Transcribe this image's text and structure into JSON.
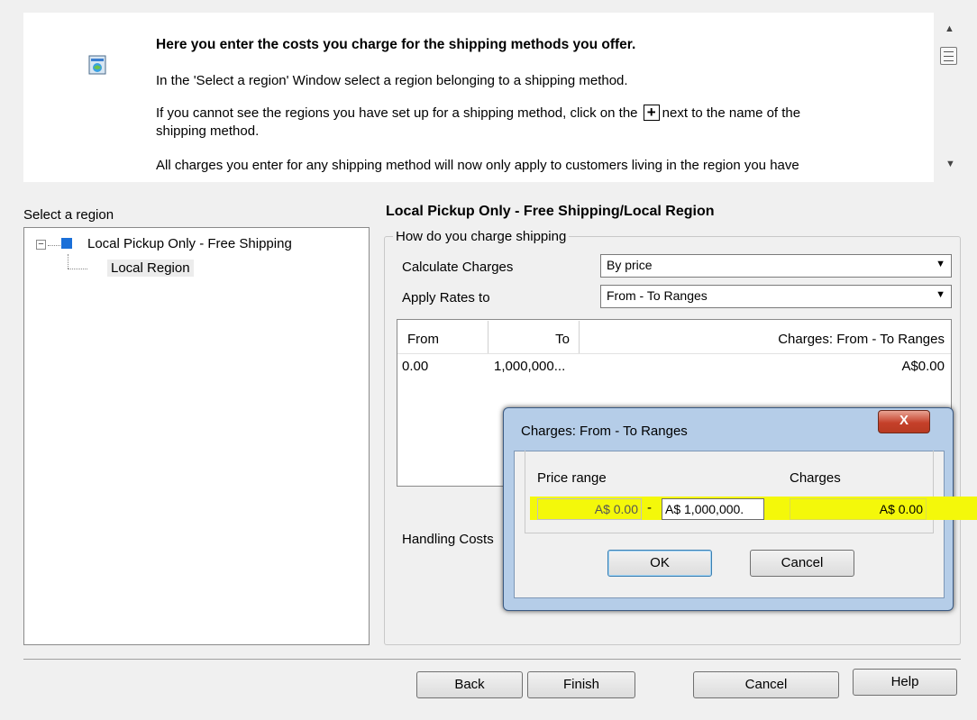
{
  "info": {
    "heading": "Here you enter the costs you charge for the shipping methods you offer.",
    "line1": "In the 'Select a region' Window select a region belonging to a shipping method.",
    "line2_before": "If you cannot see the regions you have set up for a shipping method, click on the ",
    "line2_after": "next to the name of the",
    "line2_cont": "shipping method.",
    "line3": "All charges you enter for any shipping method will now only apply to customers living in the region you have",
    "icons": {
      "info": "wizard-icon",
      "plus": "plus-icon"
    }
  },
  "tree": {
    "label": "Select a region",
    "root": "Local Pickup Only - Free Shipping",
    "child": "Local Region",
    "expander_glyph": "−"
  },
  "region_panel": {
    "title": "Local Pickup Only - Free Shipping/Local Region",
    "group_label": "How do you charge shipping",
    "calc_label": "Calculate Charges",
    "calc_value": "By price",
    "apply_label": "Apply Rates to",
    "apply_value": "From - To Ranges",
    "handling_label": "Handling Costs"
  },
  "table": {
    "headers": [
      "From",
      "To",
      "Charges:  From - To Ranges"
    ],
    "rows": [
      {
        "from": "0.00",
        "to": "1,000,000...",
        "charge": "A$0.00"
      }
    ]
  },
  "dialog": {
    "title": "Charges:  From - To Ranges",
    "close": "X",
    "price_range_label": "Price range",
    "charges_label": "Charges",
    "from_value": "A$ 0.00",
    "dash": "-",
    "to_value": "A$ 1,000,000.",
    "charges_value": "A$ 0.00",
    "ok": "OK",
    "cancel": "Cancel"
  },
  "buttons": {
    "back": "Back",
    "finish": "Finish",
    "cancel": "Cancel",
    "help": "Help"
  },
  "colors": {
    "highlight": "#f4f80a",
    "tree_icon": "#1a6fd8",
    "dialog_frame": "#b5cde8",
    "close_button": "#c5402a"
  }
}
